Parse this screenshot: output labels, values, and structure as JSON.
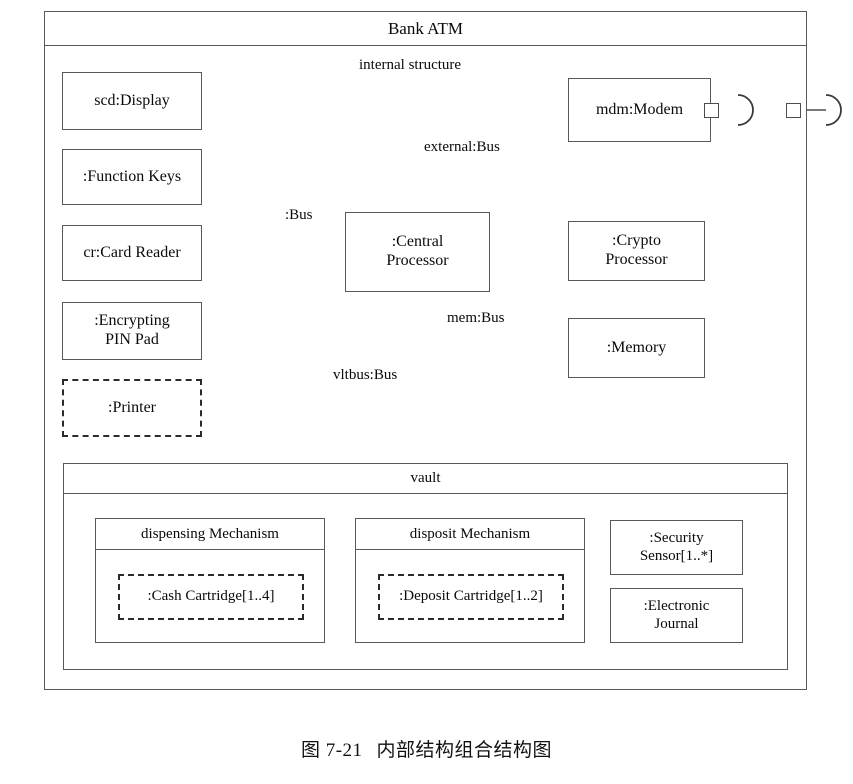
{
  "diagram": {
    "root": {
      "title": "Bank ATM",
      "internal_label": "internal structure"
    },
    "components": {
      "display": "scd:Display",
      "function_keys": ":Function Keys",
      "card_reader": "cr:Card Reader",
      "pin_pad": ":Encrypting\nPIN Pad",
      "pin_pad_line1": ":Encrypting",
      "pin_pad_line2": "PIN Pad",
      "printer": ":Printer",
      "central_processor_line1": ":Central",
      "central_processor_line2": "Processor",
      "modem": "mdm:Modem",
      "crypto_line1": ":Crypto",
      "crypto_line2": "Processor",
      "memory": ":Memory"
    },
    "connectors": {
      "bus": ":Bus",
      "external_bus": "external:Bus",
      "mem_bus": "mem:Bus",
      "vault_bus": "vltbus:Bus"
    },
    "vault": {
      "title": "vault",
      "dispensing": {
        "title": "dispensing Mechanism",
        "part": ":Cash Cartridge[1..4]"
      },
      "deposit": {
        "title": "disposit Mechanism",
        "part": ":Deposit Cartridge[1..2]"
      },
      "security_sensor_line1": ":Security",
      "security_sensor_line2": "Sensor[1..*]",
      "electronic_journal_line1": ":Electronic",
      "electronic_journal_line2": "Journal"
    },
    "caption": {
      "number": "图 7-21",
      "text": "内部结构组合结构图"
    },
    "colors": {
      "stroke": "#585858",
      "connector": "#4d4d4d",
      "dashed_stroke": "#2b2b2b",
      "text": "#0a0a0a",
      "background": "#ffffff"
    }
  }
}
